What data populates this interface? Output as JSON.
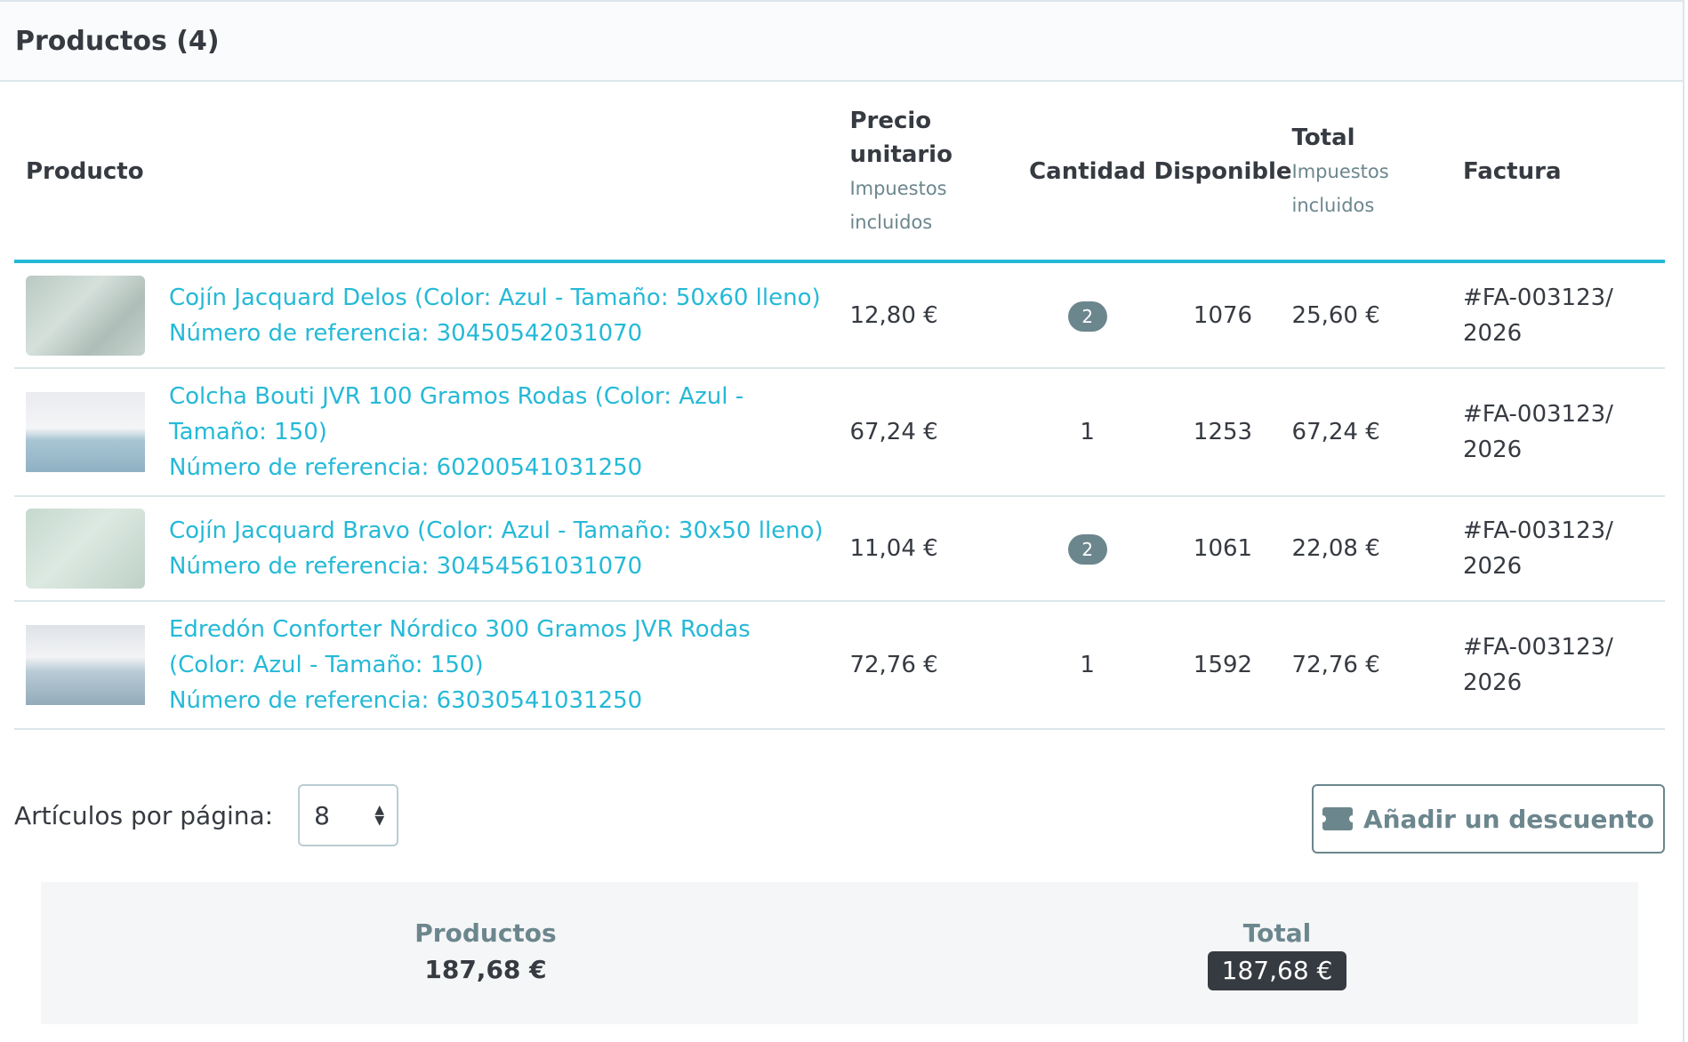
{
  "card": {
    "title": "Productos (4)"
  },
  "table": {
    "headers": {
      "product": "Producto",
      "unit_price": "Precio unitario",
      "unit_price_sub": "Impuestos incluidos",
      "quantity": "Cantidad",
      "available": "Disponible",
      "total": "Total",
      "total_sub": "Impuestos incluidos",
      "invoice": "Factura"
    },
    "rows": [
      {
        "name": "Cojín Jacquard Delos (Color: Azul - Tamaño: 50x60 lleno)",
        "reference": "Número de referencia: 30450542031070",
        "unit_price": "12,80 €",
        "quantity": "2",
        "available": "1076",
        "total": "25,60 €",
        "invoice": "#FA-003123/2026"
      },
      {
        "name": "Colcha Bouti JVR 100 Gramos Rodas (Color: Azul - Tamaño: 150)",
        "reference": "Número de referencia: 60200541031250",
        "unit_price": "67,24 €",
        "quantity": "1",
        "available": "1253",
        "total": "67,24 €",
        "invoice": "#FA-003123/2026"
      },
      {
        "name": "Cojín Jacquard Bravo (Color: Azul - Tamaño: 30x50 lleno)",
        "reference": "Número de referencia: 30454561031070",
        "unit_price": "11,04 €",
        "quantity": "2",
        "available": "1061",
        "total": "22,08 €",
        "invoice": "#FA-003123/2026"
      },
      {
        "name": "Edredón Conforter Nórdico 300 Gramos JVR Rodas (Color: Azul - Tamaño: 150)",
        "reference": "Número de referencia: 63030541031250",
        "unit_price": "72,76 €",
        "quantity": "1",
        "available": "1592",
        "total": "72,76 €",
        "invoice": "#FA-003123/2026"
      }
    ]
  },
  "pagination": {
    "label": "Artículos por página:",
    "value": "8"
  },
  "discount_button": {
    "label": "Añadir un descuento",
    "icon": "ticket-icon"
  },
  "summary": {
    "products_label": "Productos",
    "products_value": "187,68 €",
    "total_label": "Total",
    "total_value": "187,68 €"
  },
  "colors": {
    "accent": "#25b9d7",
    "badge": "#6c868e",
    "total_pill": "#363a41"
  }
}
